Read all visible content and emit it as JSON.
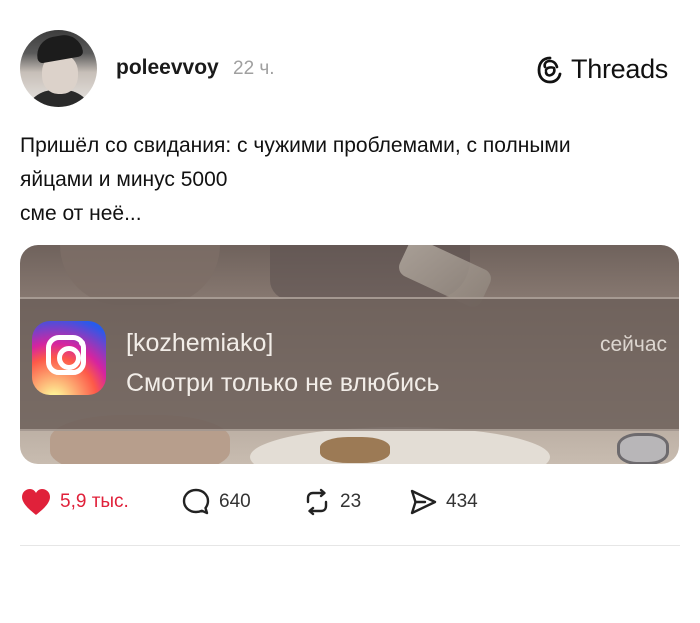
{
  "post": {
    "username": "poleevvoy",
    "time": "22 ч.",
    "text_lines": [
      "Пришёл со свидания: с чужими проблемами, с полными",
      "яйцами и минус 5000",
      "сме от неё..."
    ]
  },
  "brand": {
    "name": "Threads"
  },
  "media": {
    "notification": {
      "title": "[kozhemiako]",
      "body": "Смотри только не влюбись",
      "time": "сейчас",
      "app_icon": "instagram-icon"
    }
  },
  "actions": {
    "likes": "5,9 тыс.",
    "comments": "640",
    "reposts": "23",
    "shares": "434"
  },
  "colors": {
    "like": "#e0213a"
  }
}
